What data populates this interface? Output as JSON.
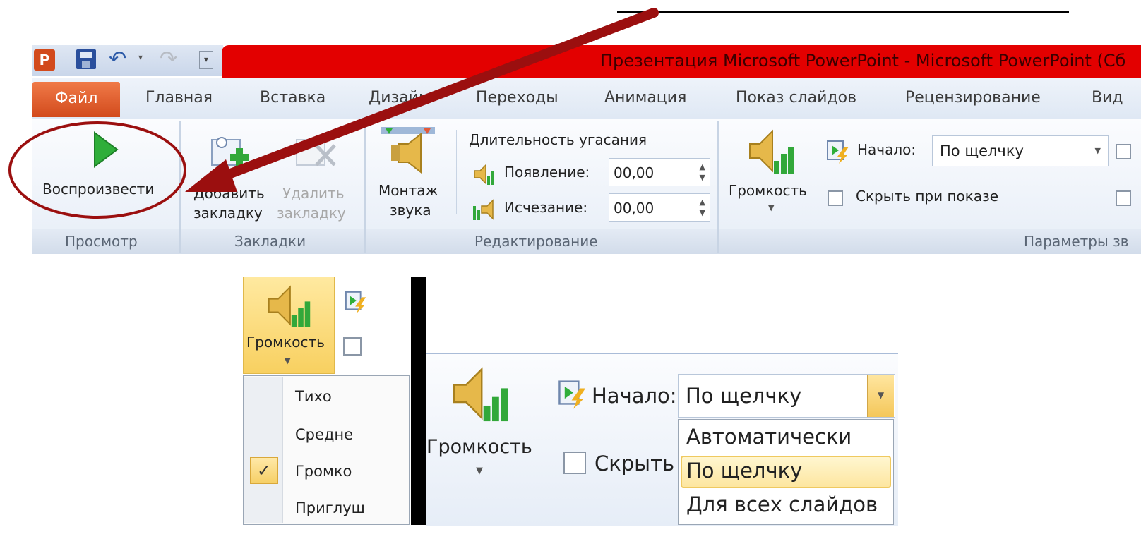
{
  "qat": {
    "logo_letter": "P"
  },
  "window": {
    "title": "Презентация Microsoft PowerPoint  -  Microsoft PowerPoint (Сб"
  },
  "tabs": [
    "Файл",
    "Главная",
    "Вставка",
    "Дизайн",
    "Переходы",
    "Анимация",
    "Показ слайдов",
    "Рецензирование",
    "Вид"
  ],
  "ribbon": {
    "preview": {
      "play_label": "Воспроизвести",
      "group": "Просмотр"
    },
    "bookmarks": {
      "add_line1": "Добавить",
      "add_line2": "закладку",
      "remove_line1": "Удалить",
      "remove_line2": "закладку",
      "group": "Закладки"
    },
    "editing": {
      "trim_line1": "Монтаж",
      "trim_line2": "звука",
      "fade_title": "Длительность угасания",
      "fade_in_label": "Появление:",
      "fade_in_value": "00,00",
      "fade_out_label": "Исчезание:",
      "fade_out_value": "00,00",
      "group": "Редактирование"
    },
    "audio_options": {
      "volume_label": "Громкость",
      "start_label": "Начало:",
      "start_value": "По щелчку",
      "hide_label": "Скрыть при показе",
      "group": "Параметры зв"
    }
  },
  "zoom_volume": {
    "button_label": "Громкость",
    "items": [
      "Тихо",
      "Средне",
      "Громко",
      "Приглуш"
    ],
    "checked_item": "Громко"
  },
  "zoom_start": {
    "volume_label": "Громкость",
    "start_label": "Начало:",
    "start_value": "По щелчку",
    "hide_label": "Скрыть п",
    "options": [
      "Автоматически",
      "По щелчку",
      "Для всех слайдов"
    ],
    "selected_option": "По щелчку"
  },
  "colors": {
    "title_bar": "#e30000",
    "file_tab": "#e05a28",
    "annotation": "#9b0f0f",
    "play_icon": "#2fae3a"
  }
}
